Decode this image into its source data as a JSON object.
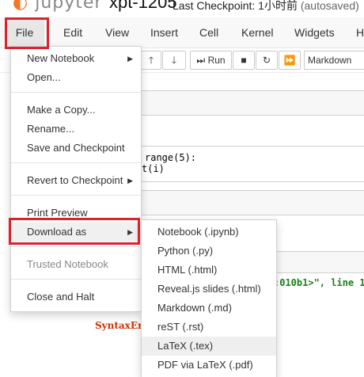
{
  "header": {
    "logo_text": "jupyter",
    "notebook_name": "xpt-1205",
    "checkpoint_text": "Last Checkpoint: 1小时前",
    "autosave_text": "(autosaved)"
  },
  "menubar": {
    "items": [
      "File",
      "Edit",
      "View",
      "Insert",
      "Cell",
      "Kernel",
      "Widgets",
      "He"
    ]
  },
  "toolbar": {
    "run_label": "Run",
    "cell_type": "Markdown",
    "up_icon": "arrow-up-icon",
    "down_icon": "arrow-down-icon",
    "stop_icon": "stop-icon",
    "restart_icon": "restart-icon",
    "fast_forward_icon": "fast-forward-icon"
  },
  "code": {
    "line1": "range(5):",
    "line2": "t(i)",
    "output_fragment": ":010b1>\", line 1",
    "error_fragment": "SyntaxEr"
  },
  "file_menu": {
    "items": [
      {
        "label": "New Notebook",
        "submenu": true
      },
      {
        "label": "Open..."
      },
      {
        "label": "Make a Copy..."
      },
      {
        "label": "Rename..."
      },
      {
        "label": "Save and Checkpoint"
      },
      {
        "label": "Revert to Checkpoint",
        "submenu": true
      },
      {
        "label": "Print Preview"
      },
      {
        "label": "Download as",
        "submenu": true
      },
      {
        "label": "Trusted Notebook",
        "disabled": true
      },
      {
        "label": "Close and Halt"
      }
    ]
  },
  "download_menu": {
    "items": [
      "Notebook (.ipynb)",
      "Python (.py)",
      "HTML (.html)",
      "Reveal.js slides (.html)",
      "Markdown (.md)",
      "reST (.rst)",
      "LaTeX (.tex)",
      "PDF via LaTeX (.pdf)"
    ]
  },
  "colors": {
    "highlight_box": "#d9232d",
    "logo_orange": "#f37726"
  }
}
